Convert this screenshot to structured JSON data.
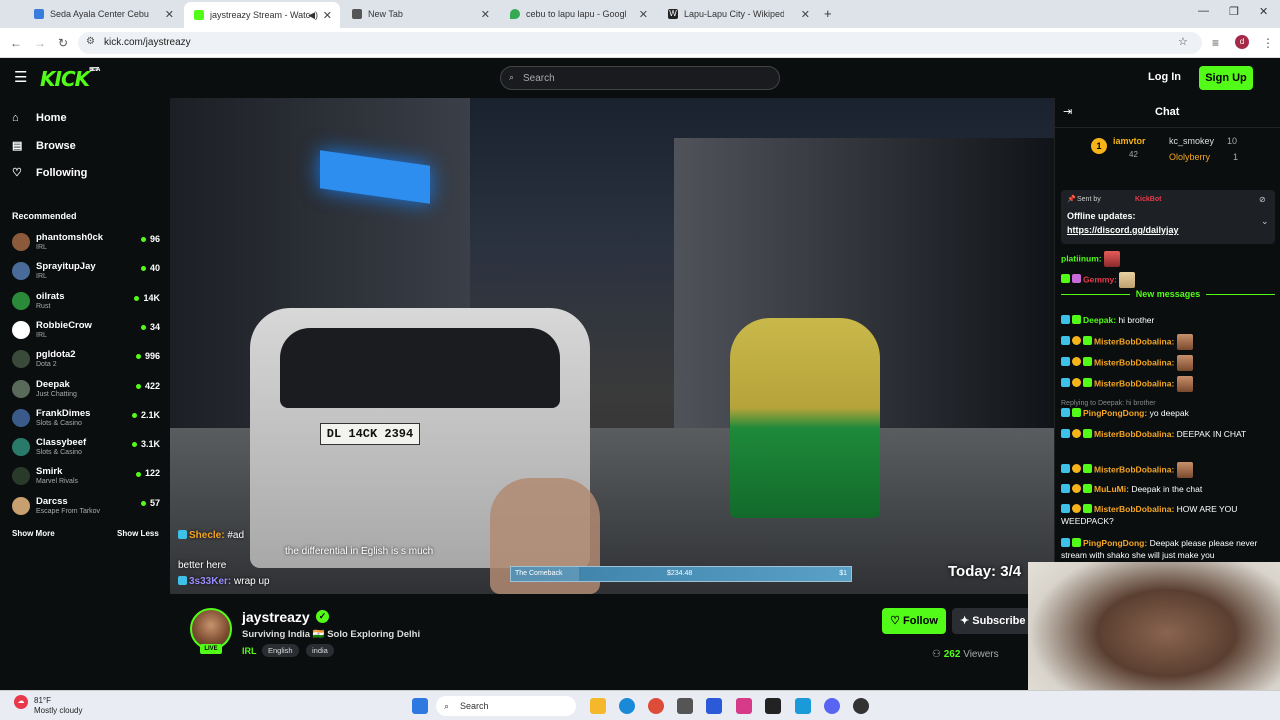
{
  "browser": {
    "tabs": [
      {
        "label": "Seda Ayala Center Cebu",
        "color": "#3a7be0"
      },
      {
        "label": "jaystreazy Stream - Watch L",
        "color": "#53fc18"
      },
      {
        "label": "New Tab",
        "color": "#555555"
      },
      {
        "label": "cebu to lapu lapu - Google Ma",
        "color": "#34a853"
      },
      {
        "label": "Lapu-Lapu City - Wikipedia",
        "color": "#222222"
      }
    ],
    "url": "kick.com/jaystreazy",
    "profile_initial": "d"
  },
  "header": {
    "logo": "KICK",
    "logo_sup": "BETA",
    "search_placeholder": "Search",
    "login": "Log In",
    "signup": "Sign Up"
  },
  "sidebar": {
    "nav": [
      {
        "label": "Home",
        "icon": "home-icon",
        "glyph": "⌂"
      },
      {
        "label": "Browse",
        "icon": "browse-icon",
        "glyph": "▤"
      },
      {
        "label": "Following",
        "icon": "heart-icon",
        "glyph": "♡"
      }
    ],
    "recommended_title": "Recommended",
    "recommended": [
      {
        "name": "phantomsh0ck",
        "category": "IRL",
        "viewers": "96",
        "color": "#8a5a3a"
      },
      {
        "name": "SprayitupJay",
        "category": "IRL",
        "viewers": "40",
        "color": "#4a6a9a"
      },
      {
        "name": "oilrats",
        "category": "Rust",
        "viewers": "14K",
        "color": "#2a8a3a"
      },
      {
        "name": "RobbieCrow",
        "category": "IRL",
        "viewers": "34",
        "color": "#ffffff"
      },
      {
        "name": "pgldota2",
        "category": "Dota 2",
        "viewers": "996",
        "color": "#3a4a3a"
      },
      {
        "name": "Deepak",
        "category": "Just Chatting",
        "viewers": "422",
        "color": "#5a6a5a"
      },
      {
        "name": "FrankDimes",
        "category": "Slots & Casino",
        "viewers": "2.1K",
        "color": "#3a5a8a"
      },
      {
        "name": "Classybeef",
        "category": "Slots & Casino",
        "viewers": "3.1K",
        "color": "#2a7a6a"
      },
      {
        "name": "Smirk",
        "category": "Marvel Rivals",
        "viewers": "122",
        "color": "#2a3a2a"
      },
      {
        "name": "Darcss",
        "category": "Escape From Tarkov",
        "viewers": "57",
        "color": "#c8a070"
      }
    ],
    "show_more": "Show More",
    "show_less": "Show Less"
  },
  "video": {
    "plate": "DL 14CK 2394",
    "overlay_chat": [
      {
        "user": "Shecle:",
        "text": "#ad",
        "color": "#f5a623"
      },
      {
        "user": "",
        "text": "the differential in Eglish is s much",
        "color": "#ffffff"
      },
      {
        "user": "",
        "text": "better here",
        "color": "#ffffff"
      },
      {
        "user": "3s33Ker:",
        "text": "wrap up",
        "color": "#9b8cff"
      }
    ],
    "goal_label": "The Comeback",
    "goal_amount": "$234.48",
    "goal_right": "$1",
    "goal_progress": 0.2,
    "today": "Today: 3/4"
  },
  "channel": {
    "name": "jaystreazy",
    "live": "LIVE",
    "title": "Surviving India 🇮🇳 Solo Exploring Delhi",
    "category": "IRL",
    "tags": [
      "English",
      "india"
    ],
    "follow": "Follow",
    "subscribe": "Subscribe",
    "viewers": "262",
    "viewers_label": "Viewers"
  },
  "chat": {
    "title": "Chat",
    "leaderboard": [
      {
        "rank": "1",
        "name": "iamvtor",
        "count": "42"
      },
      {
        "name": "kc_smokey",
        "count": "10"
      },
      {
        "name": "Ololyberry",
        "count": "1"
      }
    ],
    "pinned": {
      "sent_by_label": "Sent by",
      "sender": "KickBot",
      "text": "Offline updates:",
      "link": "https://discord.gg/dailyjay"
    },
    "pre_messages": [
      {
        "user": "platiinum:",
        "text": "",
        "color": "#53fc18"
      },
      {
        "user": "Gemmy:",
        "text": "",
        "color": "#e8394b"
      }
    ],
    "new_messages_label": "New messages",
    "messages": [
      {
        "user": "Deepak:",
        "text": "hi brother",
        "color": "#53fc18"
      },
      {
        "user": "MisterBobDobalina:",
        "text": "",
        "color": "#f5a623"
      },
      {
        "user": "MisterBobDobalina:",
        "text": "",
        "color": "#f5a623"
      },
      {
        "user": "MisterBobDobalina:",
        "text": "",
        "color": "#f5a623"
      },
      {
        "user": "",
        "text": "Replying to Deepak: hi brother",
        "color": "#888888"
      },
      {
        "user": "PingPongDong:",
        "text": "yo deepak",
        "color": "#f5a623"
      },
      {
        "user": "MisterBobDobalina:",
        "text": "DEEPAK IN CHAT",
        "color": "#f5a623"
      },
      {
        "user": "MisterBobDobalina:",
        "text": "",
        "color": "#f5a623"
      },
      {
        "user": "MuLuMi:",
        "text": "Deepak in the chat",
        "color": "#f5a623"
      },
      {
        "user": "MisterBobDobalina:",
        "text": "HOW ARE YOU WEEDPACK?",
        "color": "#f5a623"
      },
      {
        "user": "PingPongDong:",
        "text": "Deepak please please never stream with shako she will just make you",
        "color": "#f5a623"
      }
    ]
  },
  "taskbar": {
    "temp": "81°F",
    "weather": "Mostly cloudy",
    "search": "Search"
  }
}
